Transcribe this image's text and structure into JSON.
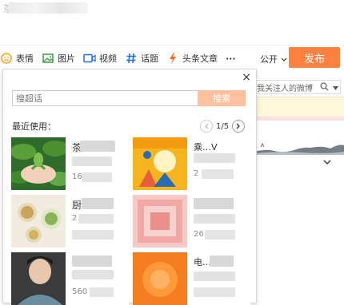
{
  "compose": {
    "text": "茶"
  },
  "toolbar": {
    "items": [
      {
        "name": "emoji",
        "label": "表情",
        "icon": "smile-icon"
      },
      {
        "name": "image",
        "label": "图片",
        "icon": "image-icon"
      },
      {
        "name": "video",
        "label": "视频",
        "icon": "video-icon"
      },
      {
        "name": "topic",
        "label": "话题",
        "icon": "hash-icon"
      },
      {
        "name": "article",
        "label": "头条文章",
        "icon": "lightning-icon"
      }
    ],
    "more": "···",
    "visibility": "公开",
    "publish": "发布"
  },
  "background": {
    "search_placeholder": "我关注人的微博"
  },
  "popup": {
    "close": "×",
    "search_placeholder": "搜超话",
    "search_button": "搜索",
    "recent_label": "最近使用：",
    "page": "1/5",
    "items": [
      {
        "title": "茶",
        "count": "16"
      },
      {
        "title": "乘…V",
        "count": "2"
      },
      {
        "title": "厨",
        "count": "2"
      },
      {
        "title": "",
        "count": "26"
      },
      {
        "title": "",
        "count": "560"
      },
      {
        "title": "电…",
        "count": ""
      }
    ]
  },
  "colors": {
    "accent": "#ff8140",
    "accent_light": "#ffc09f",
    "icon_blue": "#1f6fe0",
    "icon_green": "#3aa13f",
    "icon_yellow": "#f5a623"
  }
}
